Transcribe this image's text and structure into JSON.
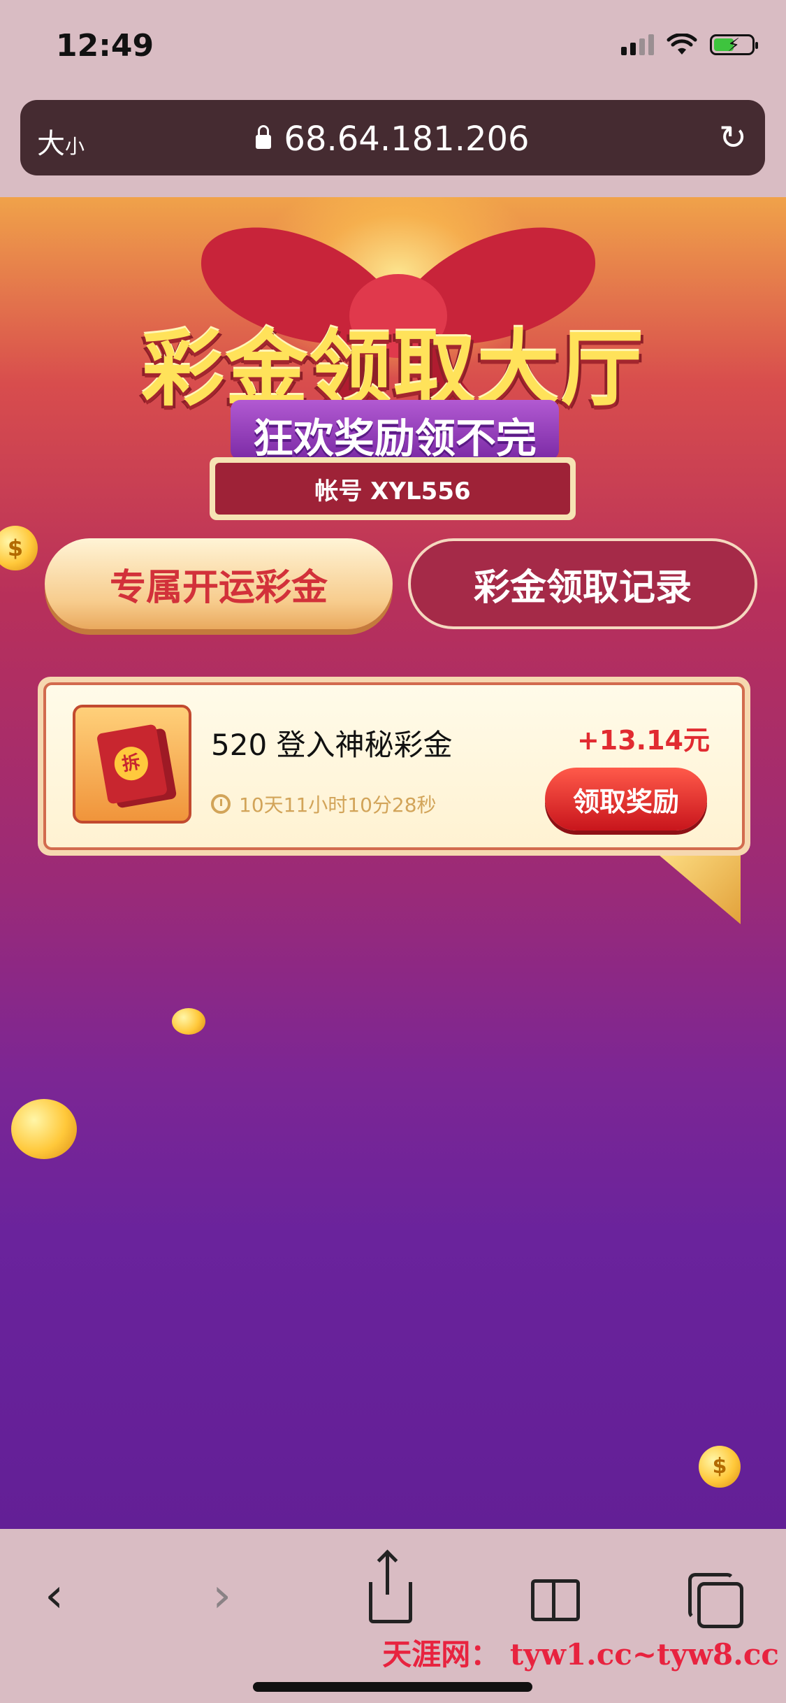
{
  "status_bar": {
    "time": "12:49",
    "icons": [
      "signal-icon",
      "wifi-icon",
      "battery-charging-icon"
    ]
  },
  "url_bar": {
    "text_size_big": "大",
    "text_size_small": "小",
    "url": "68.64.181.206",
    "icons": [
      "lock-icon",
      "reload-icon"
    ]
  },
  "hero": {
    "title": "彩金领取大厅",
    "subtitle": "狂欢奖励领不完",
    "account": "帐号 XYL556"
  },
  "tabs": {
    "exclusive": "专属开运彩金",
    "records": "彩金领取记录"
  },
  "reward": {
    "thumb_seal": "拆",
    "title": "520 登入神秘彩金",
    "amount": "+13.14元",
    "countdown": "10天11小时10分28秒",
    "claim": "领取奖励"
  },
  "bottom_nav": {
    "icons": [
      "back-icon",
      "forward-icon",
      "share-icon",
      "bookmarks-icon",
      "tabs-icon"
    ],
    "back": "‹",
    "forward": "›"
  },
  "watermark": "天涯网： tyw1.cc~tyw8.cc",
  "colors": {
    "accent_red": "#e12b31",
    "url_bar": "#452b31",
    "gold": "#ffe25a",
    "purple": "#6a239c"
  }
}
